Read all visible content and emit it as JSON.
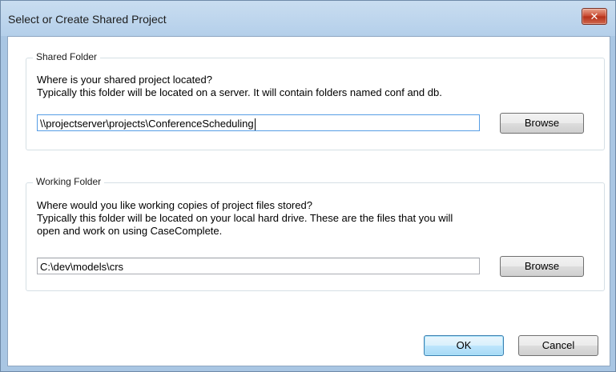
{
  "window": {
    "title": "Select or Create Shared Project",
    "close_glyph": "✕"
  },
  "shared_folder": {
    "group_title": "Shared Folder",
    "question": "Where is your shared project located?",
    "hint": "Typically this folder will be located on a server.  It will contain folders named conf and db.",
    "path_value": "\\\\projectserver\\projects\\ConferenceScheduling",
    "browse_label": "Browse"
  },
  "working_folder": {
    "group_title": "Working Folder",
    "question": "Where would you like working copies of project files stored?",
    "hint_line1": "Typically this folder will be located on your local hard drive.  These are the files that you will",
    "hint_line2": "open and work on using CaseComplete.",
    "path_value": "C:\\dev\\models\\crs",
    "browse_label": "Browse"
  },
  "buttons": {
    "ok_label": "OK",
    "cancel_label": "Cancel"
  },
  "colors": {
    "title_bar": "#b4cfea",
    "close_button": "#c7452c",
    "default_button_border": "#3c7fb1"
  }
}
